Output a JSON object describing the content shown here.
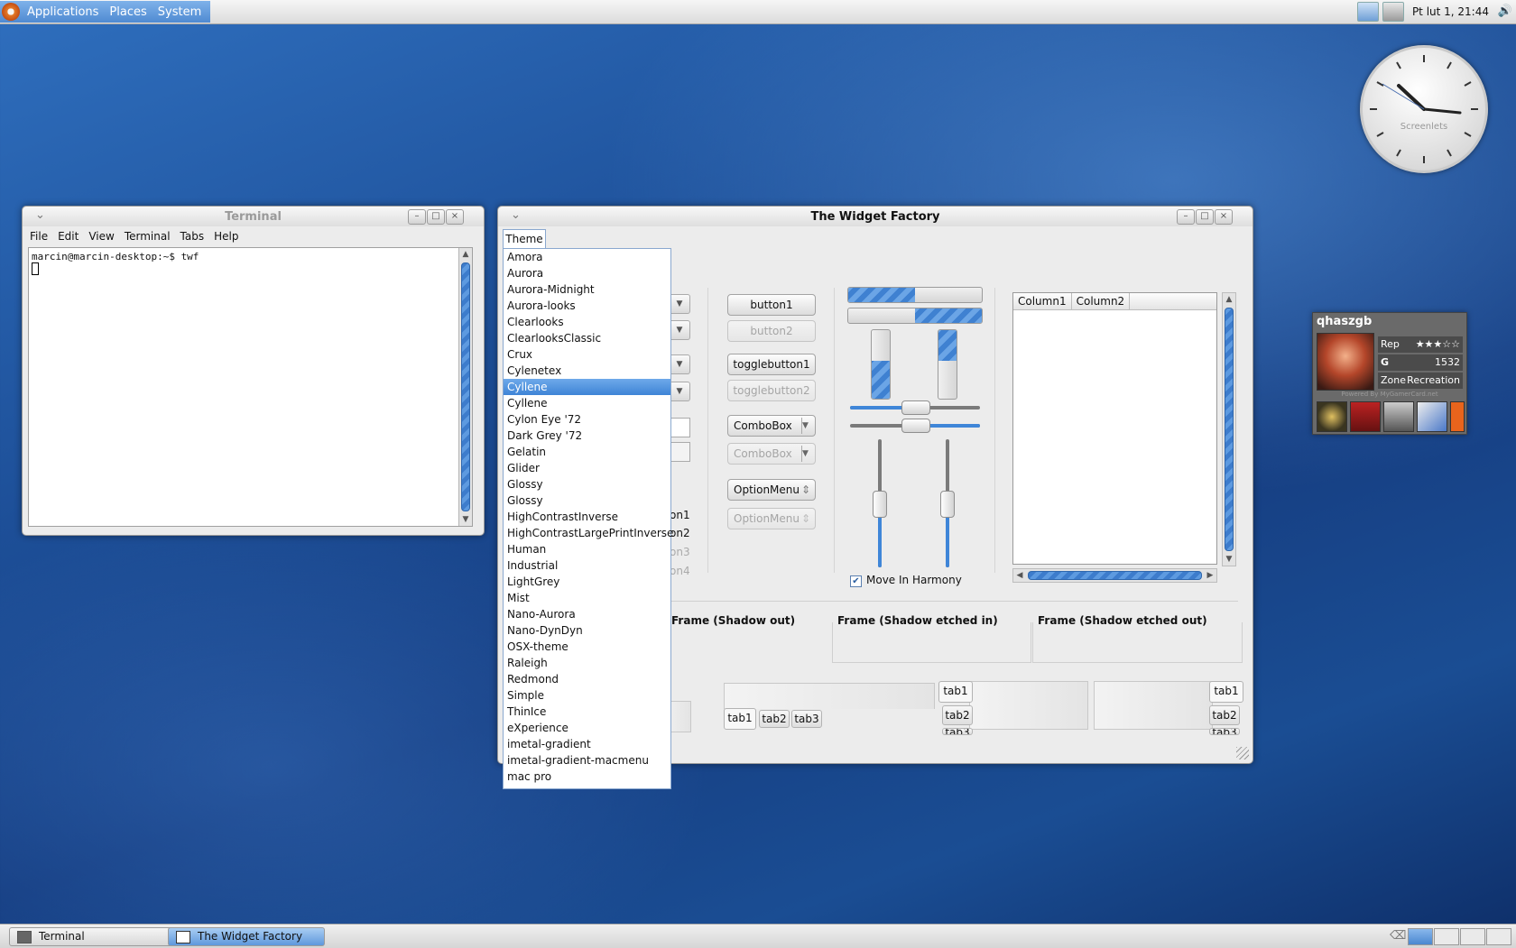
{
  "top_panel": {
    "menus": [
      "Applications",
      "Places",
      "System"
    ],
    "clock": "Pt lut  1, 21:44"
  },
  "terminal": {
    "title": "Terminal",
    "menus": [
      "File",
      "Edit",
      "View",
      "Terminal",
      "Tabs",
      "Help"
    ],
    "prompt_line": "marcin@marcin-desktop:~$ twf"
  },
  "twf": {
    "title": "The Widget Factory",
    "theme_menu": {
      "label": "Theme",
      "selected": "Cyllene",
      "items": [
        "Amora",
        "Aurora",
        "Aurora-Midnight",
        "Aurora-looks",
        "Clearlooks",
        "ClearlooksClassic",
        "Crux",
        "Cylenetex",
        "Cyllene",
        "Cyllene",
        "Cylon Eye '72",
        "Dark Grey '72",
        "Gelatin",
        "Glider",
        "Glossy",
        "Glossy",
        "HighContrastInverse",
        "HighContrastLargePrintInverse",
        "Human",
        "Industrial",
        "LightGrey",
        "Mist",
        "Nano-Aurora",
        "Nano-DynDyn",
        "OSX-theme",
        "Raleigh",
        "Redmond",
        "Simple",
        "ThinIce",
        "eXperience",
        "imetal-gradient",
        "imetal-gradient-macmenu",
        "mac pro"
      ]
    },
    "buttons": {
      "button1": "button1",
      "button2": "button2",
      "togglebutton1": "togglebutton1",
      "togglebutton2": "togglebutton2",
      "combobox1": "ComboBox",
      "combobox2": "ComboBox",
      "optionmenu1": "OptionMenu",
      "optionmenu2": "OptionMenu"
    },
    "partial_labels": [
      "on1",
      "on2",
      "on3",
      "on4"
    ],
    "progress": {
      "h1": 0.5,
      "h2": 0.5,
      "v1": 0.55,
      "v2": 0.45
    },
    "scales": {
      "h1": 0.5,
      "h2": 0.5,
      "v1": 0.5,
      "v2": 0.5
    },
    "move_in_harmony": {
      "label": "Move In Harmony",
      "checked": true
    },
    "tree": {
      "columns": [
        "Column1",
        "Column2"
      ]
    },
    "frames": [
      "Frame (Shadow out)",
      "Frame (Shadow etched in)",
      "Frame (Shadow etched out)"
    ],
    "tabs": [
      "tab1",
      "tab2",
      "tab3"
    ]
  },
  "screenlet_clock": {
    "label": "Screenlets"
  },
  "gamercard": {
    "gamertag": "qhaszgb",
    "rep_label": "Rep",
    "rep_stars": 3,
    "rep_max": 5,
    "gamerscore_label": "G",
    "gamerscore": "1532",
    "zone_label": "Zone",
    "zone": "Recreation",
    "footer": "Powered By MyGamerCard.net"
  },
  "taskbar": {
    "tasks": [
      {
        "label": "Terminal",
        "active": false
      },
      {
        "label": "The Widget Factory",
        "active": true
      }
    ]
  },
  "colors": {
    "accent": "#3f86d8",
    "panel_menu": "#4f8ad2"
  }
}
